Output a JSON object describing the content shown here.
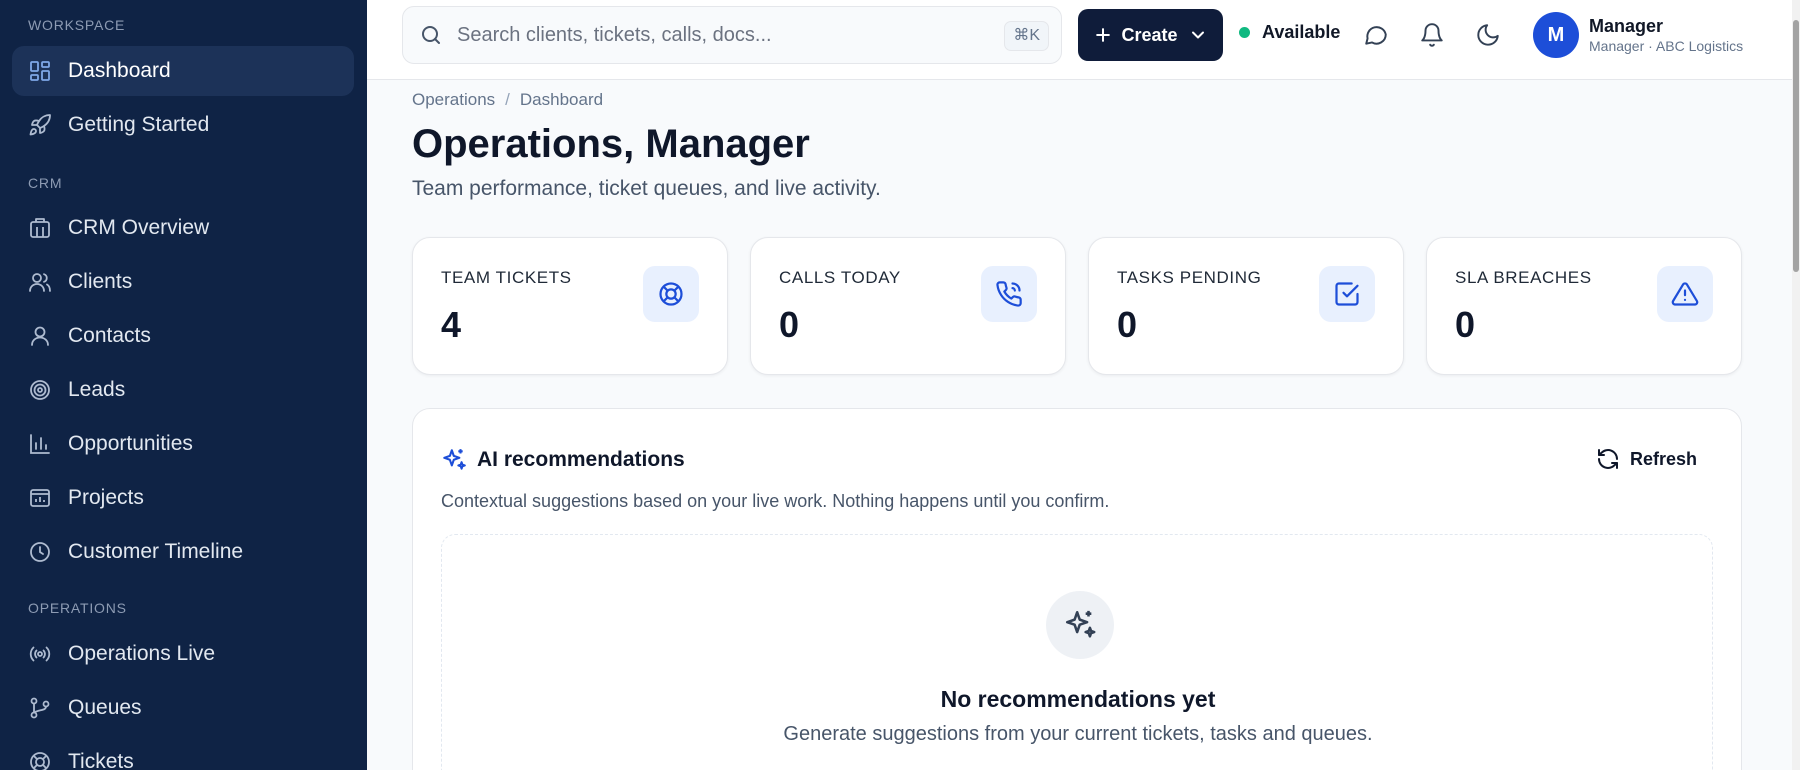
{
  "sidebar": {
    "sections": {
      "workspace": "WORKSPACE",
      "crm": "CRM",
      "operations": "OPERATIONS"
    },
    "items": [
      {
        "label": "Dashboard",
        "icon": "dashboard-icon",
        "active": true
      },
      {
        "label": "Getting Started",
        "icon": "rocket-icon"
      },
      {
        "label": "CRM Overview",
        "icon": "building-icon"
      },
      {
        "label": "Clients",
        "icon": "users-icon"
      },
      {
        "label": "Contacts",
        "icon": "user-icon"
      },
      {
        "label": "Leads",
        "icon": "target-icon"
      },
      {
        "label": "Opportunities",
        "icon": "bar-chart-icon"
      },
      {
        "label": "Projects",
        "icon": "folder-chart-icon"
      },
      {
        "label": "Customer Timeline",
        "icon": "clock-icon"
      },
      {
        "label": "Operations Live",
        "icon": "broadcast-icon"
      },
      {
        "label": "Queues",
        "icon": "branch-icon"
      },
      {
        "label": "Tickets",
        "icon": "lifebuoy-icon"
      }
    ]
  },
  "topbar": {
    "search_placeholder": "Search clients, tickets, calls, docs...",
    "search_shortcut": "⌘K",
    "create_label": "Create",
    "status_label": "Available",
    "status_color": "#10b981",
    "avatar_initial": "M",
    "user_name": "Manager",
    "user_subtitle": "Manager · ABC Logistics"
  },
  "breadcrumb": [
    "Operations",
    "Dashboard"
  ],
  "page": {
    "title": "Operations, Manager",
    "subtitle": "Team performance, ticket queues, and live activity."
  },
  "stats": [
    {
      "label": "TEAM TICKETS",
      "value": "4",
      "icon": "lifebuoy-icon"
    },
    {
      "label": "CALLS TODAY",
      "value": "0",
      "icon": "phone-call-icon"
    },
    {
      "label": "TASKS PENDING",
      "value": "0",
      "icon": "check-square-icon"
    },
    {
      "label": "SLA BREACHES",
      "value": "0",
      "icon": "warning-icon"
    }
  ],
  "ai": {
    "title": "AI recommendations",
    "refresh_label": "Refresh",
    "description": "Contextual suggestions based on your live work. Nothing happens until you confirm.",
    "empty_title": "No recommendations yet",
    "empty_subtitle": "Generate suggestions from your current tickets, tasks and queues."
  },
  "colors": {
    "sidebar_bg": "#0f2345",
    "accent": "#1d4ed8",
    "create_bg": "#0f1c3a"
  }
}
